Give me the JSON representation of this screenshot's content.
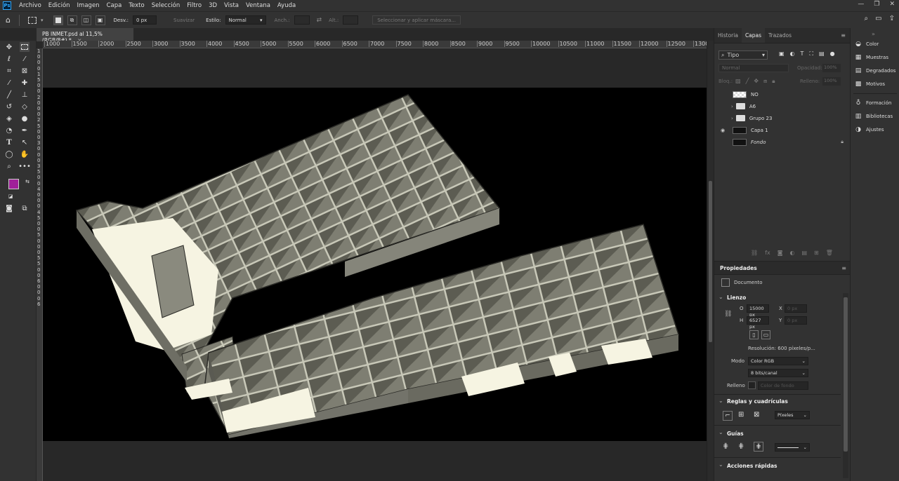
{
  "app": {
    "logo": "Ps",
    "accent": "#31a8ff"
  },
  "menu": [
    "Archivo",
    "Edición",
    "Imagen",
    "Capa",
    "Texto",
    "Selección",
    "Filtro",
    "3D",
    "Vista",
    "Ventana",
    "Ayuda"
  ],
  "window_controls": {
    "minimize": "—",
    "restore": "❐",
    "close": "✕"
  },
  "options": {
    "desv_label": "Desv.:",
    "desv_value": "0 px",
    "suavizar": "Suavizar",
    "estilo_label": "Estilo:",
    "estilo_value": "Normal",
    "anch_label": "Anch.:",
    "alt_label": "Alt.:",
    "mask_button": "Seleccionar y aplicar máscara..."
  },
  "doc_tab": {
    "title": "PB INMET.psd al 11,5% (RGB/8#) *",
    "close": "×"
  },
  "ruler_h": [
    "1000",
    "1500",
    "2000",
    "2500",
    "3000",
    "3500",
    "4000",
    "4500",
    "5000",
    "5500",
    "6000",
    "6500",
    "7000",
    "7500",
    "8000",
    "8500",
    "9000",
    "9500",
    "10000",
    "10500",
    "11000",
    "11500",
    "12000",
    "12500",
    "1300"
  ],
  "ruler_v": [
    "1",
    "0",
    "0",
    "0",
    "1",
    "5",
    "0",
    "0",
    "2",
    "0",
    "0",
    "0",
    "2",
    "5",
    "0",
    "0",
    "3",
    "0",
    "0",
    "0",
    "3",
    "5",
    "0",
    "0",
    "4",
    "0",
    "0",
    "0",
    "4",
    "5",
    "0",
    "0",
    "5",
    "0",
    "0",
    "0",
    "5",
    "5",
    "0",
    "0",
    "6",
    "0",
    "0",
    "0",
    "6"
  ],
  "tools": {
    "fg_color": "#a0209a",
    "bg_color": "#ffffff"
  },
  "layers_panel": {
    "tabs": [
      "Historia",
      "Capas",
      "Trazados"
    ],
    "filter_label": "Tipo",
    "blend_mode": "Normal",
    "opacity_label": "Opacidad:",
    "opacity_value": "100%",
    "lock_label": "Bloq.:",
    "fill_label": "Relleno:",
    "fill_value": "100%",
    "layers": [
      {
        "name": "NO",
        "kind": "checker",
        "visible": false
      },
      {
        "name": "A6",
        "kind": "folder",
        "visible": false
      },
      {
        "name": "Grupo 23",
        "kind": "folder",
        "visible": false
      },
      {
        "name": "Capa 1",
        "kind": "image",
        "visible": true
      },
      {
        "name": "Fondo",
        "kind": "image",
        "visible": false,
        "locked": true
      }
    ]
  },
  "properties": {
    "title": "Propiedades",
    "type": "Documento",
    "lienzo": "Lienzo",
    "w_label": "O",
    "w_value": "15000 px",
    "x_label": "X",
    "x_value": "0 px",
    "h_label": "H",
    "h_value": "6527 px",
    "y_label": "Y",
    "y_value": "0 px",
    "resolution": "Resolución: 600 píxeles/p...",
    "mode_label": "Modo",
    "mode_value": "Color RGB",
    "depth_value": "8 bits/canal",
    "fill_label": "Relleno",
    "fill_value": "Color de fondo",
    "rulers_section": "Reglas y cuadrículas",
    "units_value": "Píxeles",
    "guides_section": "Guías",
    "quick_actions": "Acciones rápidas"
  },
  "far_right": [
    "Color",
    "Muestras",
    "Degradados",
    "Motivos",
    "Formación",
    "Bibliotecas",
    "Ajustes"
  ]
}
